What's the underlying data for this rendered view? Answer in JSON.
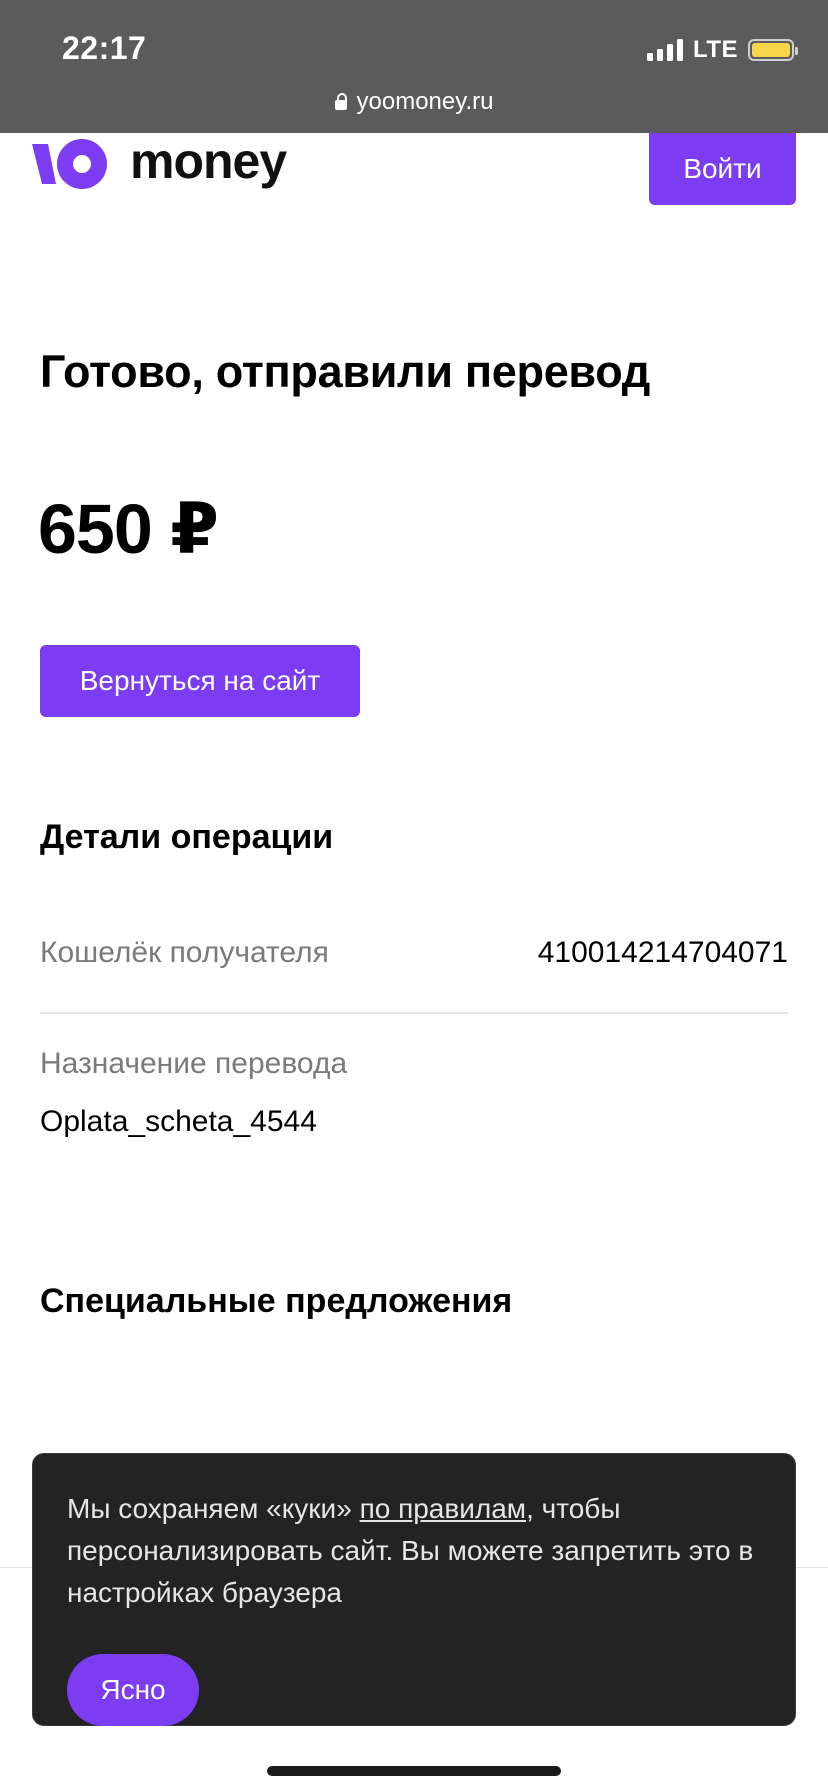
{
  "status_bar": {
    "time": "22:17",
    "network": "LTE"
  },
  "browser": {
    "url": "yoomoney.ru"
  },
  "header": {
    "logo_text": "money",
    "login_label": "Войти"
  },
  "main": {
    "title": "Готово, отправили перевод",
    "amount": "650 ₽",
    "back_button_label": "Вернуться на сайт",
    "details_title": "Детали операции",
    "details": {
      "wallet_label": "Кошелёк получателя",
      "wallet_value": "410014214704071",
      "purpose_label": "Назначение перевода",
      "purpose_value": "Oplata_scheta_4544"
    },
    "offers_title": "Специальные предложения"
  },
  "cookie_banner": {
    "text_before": "Мы сохраняем «куки» ",
    "link_text": "по правилам",
    "text_after": ", чтобы персонализировать сайт. Вы можете запретить это в настройках браузера",
    "ok_label": "Ясно"
  },
  "colors": {
    "accent": "#7b3cf2",
    "status_bar_bg": "#5b5b5b",
    "banner_bg": "#232323",
    "battery": "#f7d54a"
  },
  "icons": {
    "lock": "lock-icon",
    "signal": "signal-icon",
    "battery": "battery-icon",
    "logo": "yoomoney-logo-icon"
  }
}
